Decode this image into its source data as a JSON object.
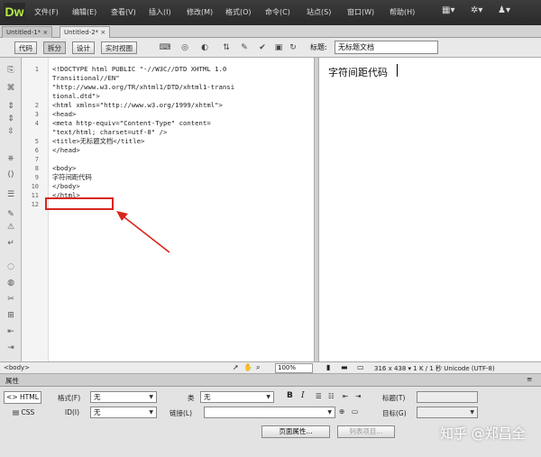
{
  "app": {
    "logo": "Dw"
  },
  "menu": [
    "文件(F)",
    "编辑(E)",
    "查看(V)",
    "插入(I)",
    "修改(M)",
    "格式(O)",
    "命令(C)",
    "站点(S)",
    "窗口(W)",
    "帮助(H)"
  ],
  "tabs": [
    "Untitled-1*",
    "Untitled-2*"
  ],
  "toolbar": {
    "views": [
      "代码",
      "拆分",
      "设计",
      "实时视图"
    ],
    "title_label": "标题:",
    "title_value": "无标题文档"
  },
  "code": {
    "line_numbers": [
      "1",
      "",
      "",
      "",
      "2",
      "3",
      "4",
      "",
      "5",
      "6",
      "7",
      "8",
      "9",
      "10",
      "11",
      "12"
    ],
    "lines": [
      "<!DOCTYPE html PUBLIC \"-//W3C//DTD XHTML 1.0",
      "Transitional//EN\"",
      "\"http://www.w3.org/TR/xhtml1/DTD/xhtml1-transi",
      "tional.dtd\">",
      "<html xmlns=\"http://www.w3.org/1999/xhtml\">",
      "<head>",
      "<meta http-equiv=\"Content-Type\" content=",
      "\"text/html; charset=utf-8\" />",
      "<title>无标题文档</title>",
      "</head>",
      "",
      "<body>",
      "字符间距代码",
      "</body>",
      "</html>",
      ""
    ]
  },
  "design": {
    "text": "字符间距代码"
  },
  "status": {
    "tag": "<body>",
    "zoom": "100%",
    "info": "316 x 438 ▾ 1 K / 1 秒 Unicode (UTF-8)"
  },
  "properties": {
    "header": "属性",
    "modes": [
      "<> HTML",
      "CSS"
    ],
    "format_label": "格式(F)",
    "format_value": "无",
    "class_label": "类",
    "class_value": "无",
    "id_label": "ID(I)",
    "id_value": "无",
    "link_label": "链接(L)",
    "title_label": "标题(T)",
    "target_label": "目标(G)",
    "page_props_button": "页面属性...",
    "list_item_button": "列表项目..."
  },
  "watermark": "知乎 @郑昌全"
}
